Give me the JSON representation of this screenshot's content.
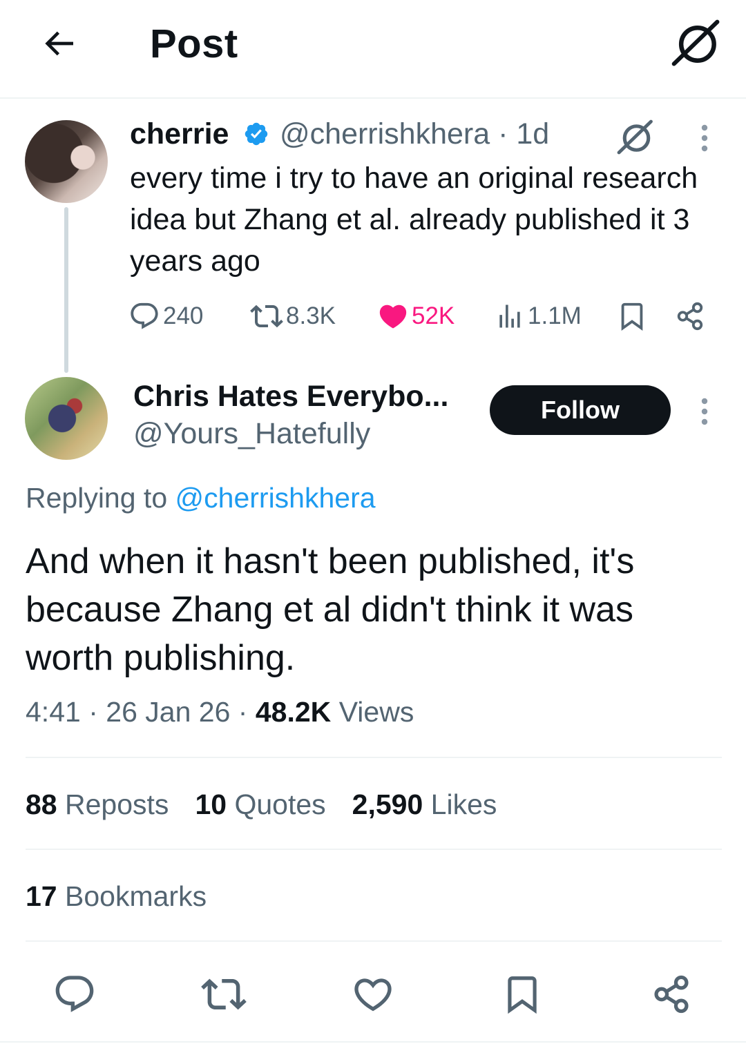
{
  "header": {
    "title": "Post",
    "back_icon": "arrow-left-icon",
    "grok_icon": "grok-icon"
  },
  "parent_tweet": {
    "name": "cherrie",
    "verified": true,
    "handle": "@cherrishkhera",
    "time": "· 1d",
    "text": "every time i try to have an original research idea but Zhang et al. already published it 3 years ago",
    "actions": {
      "replies": "240",
      "reposts": "8.3K",
      "likes": "52K",
      "views": "1.1M"
    },
    "like_color": "#f91880"
  },
  "reply": {
    "name": "Chris Hates Everybo...",
    "handle": "@Yours_Hatefully",
    "follow_label": "Follow",
    "replying_prefix": "Replying to",
    "replying_mention": "@cherrishkhera",
    "text": "And when it hasn't been published, it's because Zhang et al didn't think it was worth publishing.",
    "time": "4:41",
    "date": "26 Jan 26",
    "views_count": "48.2K",
    "views_label": "Views",
    "separator": "·"
  },
  "stats": {
    "reposts_count": "88",
    "reposts_label": "Reposts",
    "quotes_count": "10",
    "quotes_label": "Quotes",
    "likes_count": "2,590",
    "likes_label": "Likes",
    "bookmarks_count": "17",
    "bookmarks_label": "Bookmarks"
  },
  "colors": {
    "link": "#1d9bf0",
    "secondary_text": "#536471",
    "primary_text": "#0f1419"
  }
}
